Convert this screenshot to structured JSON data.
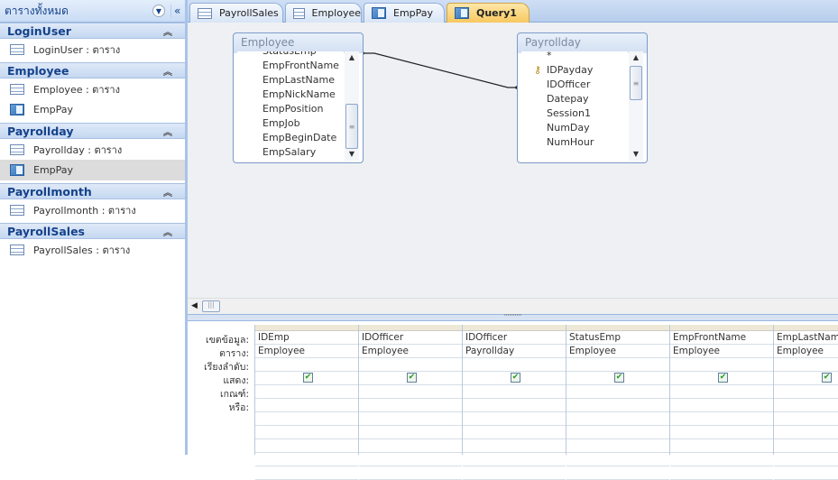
{
  "sidebar": {
    "title": "ตารางทั้งหมด",
    "groups": [
      {
        "name": "LoginUser",
        "items": [
          {
            "label": "LoginUser : ตาราง",
            "type": "table"
          }
        ]
      },
      {
        "name": "Employee",
        "items": [
          {
            "label": "Employee : ตาราง",
            "type": "table"
          },
          {
            "label": "EmpPay",
            "type": "query"
          }
        ]
      },
      {
        "name": "Payrollday",
        "items": [
          {
            "label": "Payrollday : ตาราง",
            "type": "table"
          },
          {
            "label": "EmpPay",
            "type": "query",
            "selected": true
          }
        ]
      },
      {
        "name": "Payrollmonth",
        "items": [
          {
            "label": "Payrollmonth : ตาราง",
            "type": "table"
          }
        ]
      },
      {
        "name": "PayrollSales",
        "items": [
          {
            "label": "PayrollSales : ตาราง",
            "type": "table"
          }
        ]
      }
    ]
  },
  "tabs": [
    {
      "label": "PayrollSales",
      "type": "table"
    },
    {
      "label": "Employee",
      "type": "table"
    },
    {
      "label": "EmpPay",
      "type": "query"
    },
    {
      "label": "Query1",
      "type": "query",
      "active": true
    }
  ],
  "tables": {
    "employee": {
      "title": "Employee",
      "fields": [
        "StatusEmp",
        "EmpFrontName",
        "EmpLastName",
        "EmpNickName",
        "EmpPosition",
        "EmpJob",
        "EmpBeginDate",
        "EmpSalary"
      ]
    },
    "payrollday": {
      "title": "Payrollday",
      "fields": [
        "*",
        "IDPayday",
        "IDOfficer",
        "Datepay",
        "Session1",
        "NumDay",
        "NumHour"
      ],
      "key_field": "IDPayday"
    }
  },
  "grid": {
    "row_labels": [
      "เขตข้อมูล:",
      "ตาราง:",
      "เรียงลำดับ:",
      "แสดง:",
      "เกณฑ์:",
      "หรือ:"
    ],
    "columns": [
      {
        "field": "IDEmp",
        "table": "Employee",
        "show": true
      },
      {
        "field": "IDOfficer",
        "table": "Employee",
        "show": true
      },
      {
        "field": "IDOfficer",
        "table": "Payrollday",
        "show": true
      },
      {
        "field": "StatusEmp",
        "table": "Employee",
        "show": true
      },
      {
        "field": "EmpFrontName",
        "table": "Employee",
        "show": true
      },
      {
        "field": "EmpLastName",
        "table": "Employee",
        "show": true
      }
    ]
  }
}
